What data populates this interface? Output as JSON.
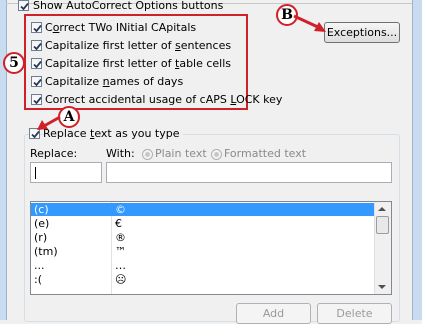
{
  "options": {
    "show_buttons": "Show AutoCorrect Options buttons",
    "items": [
      {
        "pre": "C",
        "u": "o",
        "post": "rrect TWo INitial CApitals"
      },
      {
        "pre": "Capitalize first letter of ",
        "u": "s",
        "post": "entences"
      },
      {
        "pre": "Capitalize first letter of ",
        "u": "t",
        "post": "able cells"
      },
      {
        "pre": "Capitalize ",
        "u": "n",
        "post": "ames of days"
      },
      {
        "pre": "Correct accidental usage of cAPS ",
        "u": "L",
        "post": "OCK key"
      }
    ]
  },
  "buttons": {
    "exceptions": "Exceptions...",
    "add": "Add",
    "delete": "Delete"
  },
  "replace_section": {
    "label_pre": "Replace ",
    "label_u": "t",
    "label_post": "ext as you type",
    "replace_label": "Replace:",
    "with_label": "With:",
    "plain_text": "Plain text",
    "formatted_text": "Formatted text"
  },
  "table": {
    "rows": [
      {
        "replace": "(c)",
        "with": "©",
        "selected": true
      },
      {
        "replace": "(e)",
        "with": "€",
        "selected": false
      },
      {
        "replace": "(r)",
        "with": "®",
        "selected": false
      },
      {
        "replace": "(tm)",
        "with": "™",
        "selected": false
      },
      {
        "replace": "...",
        "with": "…",
        "selected": false
      },
      {
        "replace": ":(",
        "with": "☹",
        "selected": false
      }
    ]
  },
  "annotations": {
    "number": "5",
    "a": "A",
    "b": "B",
    "color": "#d0202a"
  }
}
